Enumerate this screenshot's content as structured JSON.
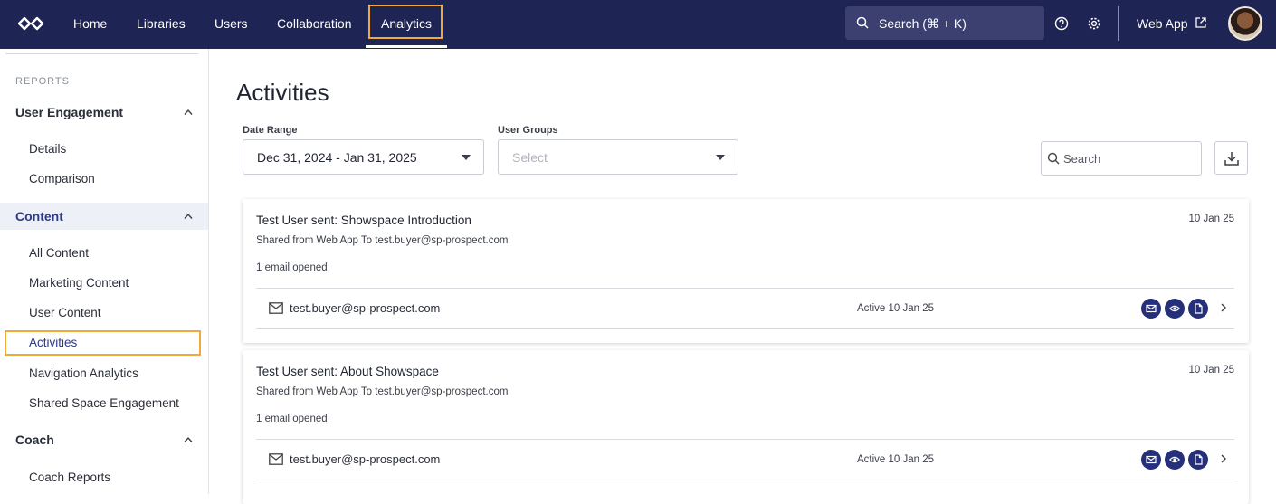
{
  "topbar": {
    "nav": [
      "Home",
      "Libraries",
      "Users",
      "Collaboration",
      "Analytics"
    ],
    "active_nav": "Analytics",
    "search_placeholder": "Search (⌘ + K)",
    "web_app_label": "Web App",
    "colors": {
      "bar": "#1e2453",
      "highlight": "#f2a93b"
    }
  },
  "sidebar": {
    "section_label": "REPORTS",
    "sections": [
      {
        "title": "User Engagement",
        "items": [
          "Details",
          "Comparison"
        ]
      },
      {
        "title": "Content",
        "items": [
          "All Content",
          "Marketing Content",
          "User Content",
          "Activities",
          "Navigation Analytics",
          "Shared Space Engagement"
        ]
      },
      {
        "title": "Coach",
        "items": [
          "Coach Reports"
        ]
      }
    ],
    "active_item": "Activities"
  },
  "main": {
    "title": "Activities",
    "filters": {
      "date_range_label": "Date Range",
      "date_range_value": "Dec 31, 2024 - Jan 31, 2025",
      "user_groups_label": "User Groups",
      "user_groups_placeholder": "Select"
    },
    "search_placeholder": "Search",
    "activities": [
      {
        "title": "Test User sent: Showspace Introduction",
        "date": "10 Jan 25",
        "shared": "Shared from Web App To test.buyer@sp-prospect.com",
        "count": "1 email opened",
        "recipient": {
          "email": "test.buyer@sp-prospect.com",
          "active": "Active 10 Jan 25"
        }
      },
      {
        "title": "Test User sent: About Showspace",
        "date": "10 Jan 25",
        "shared": "Shared from Web App To test.buyer@sp-prospect.com",
        "count": "1 email opened",
        "recipient": {
          "email": "test.buyer@sp-prospect.com",
          "active": "Active 10 Jan 25"
        }
      }
    ],
    "badge_icons": [
      "mail-icon",
      "eye-icon",
      "document-icon"
    ]
  }
}
